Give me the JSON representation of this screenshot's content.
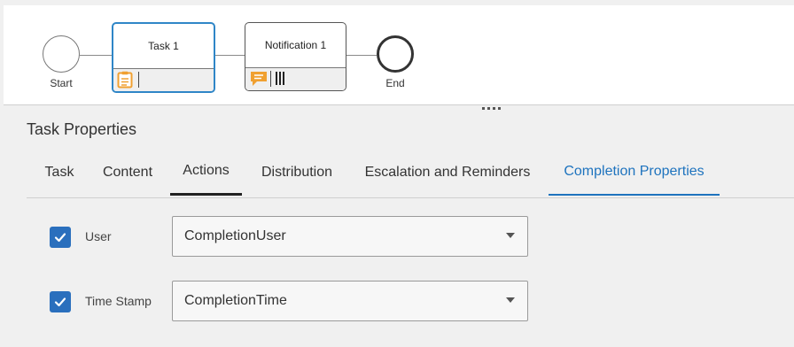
{
  "diagram": {
    "start_label": "Start",
    "end_label": "End",
    "task_title": "Task 1",
    "notification_title": "Notification 1"
  },
  "panel": {
    "title": "Task Properties",
    "tabs": [
      {
        "label": "Task"
      },
      {
        "label": "Content"
      },
      {
        "label": "Actions"
      },
      {
        "label": "Distribution"
      },
      {
        "label": "Escalation and Reminders"
      },
      {
        "label": "Completion Properties"
      }
    ],
    "rows": [
      {
        "label": "User",
        "checked": true,
        "value": "CompletionUser"
      },
      {
        "label": "Time Stamp",
        "checked": true,
        "value": "CompletionTime"
      }
    ]
  },
  "colors": {
    "accent": "#1e73be",
    "checkbox": "#2a6fbd",
    "task_border": "#2f86c7",
    "icon_orange": "#f0a030"
  }
}
